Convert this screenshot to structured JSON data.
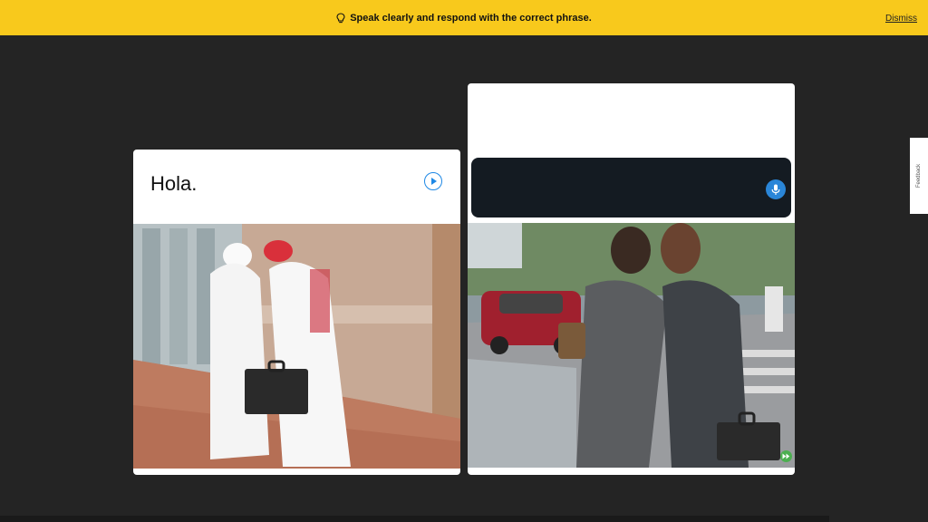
{
  "banner": {
    "message": "Speak clearly and respond with the correct phrase.",
    "icon": "lightbulb-icon",
    "dismiss_label": "Dismiss",
    "color": "#f8c91c"
  },
  "prompt_card": {
    "phrase": "Hola.",
    "play_icon": "play-icon",
    "image_subject": "two men in traditional Arab dress greeting each other"
  },
  "response_card": {
    "mic_icon": "microphone-icon",
    "image_subject": "two women greeting with a cheek kiss on a city street",
    "skip_icon": "fast-forward-icon"
  },
  "feedback": {
    "label": "Feedback"
  },
  "colors": {
    "accent_blue": "#1e88e5",
    "dark_bg": "#242424",
    "response_bg": "#141b22",
    "skip_green": "#4caf50"
  }
}
